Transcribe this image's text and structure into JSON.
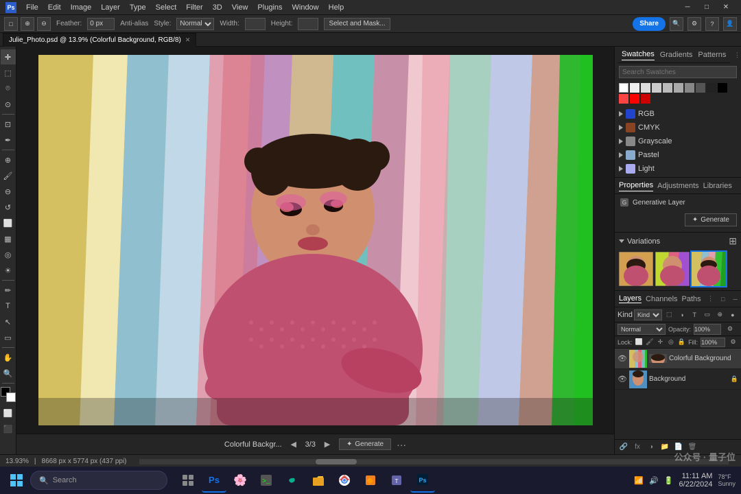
{
  "titlebar": {
    "app_title": "Photoshop",
    "file_name": "Julie_Photo.psd @ 13.9% (Colorful Background, RGB/8)",
    "menus": [
      "File",
      "Edit",
      "Image",
      "Layer",
      "Type",
      "Select",
      "Filter",
      "3D",
      "View",
      "Plugins",
      "Window",
      "Help"
    ],
    "win_min": "─",
    "win_max": "□",
    "win_close": "✕"
  },
  "optionsbar": {
    "feather_label": "Feather:",
    "feather_value": "0 px",
    "anti_alias_label": "Anti-alias",
    "style_label": "Style:",
    "style_value": "Normal",
    "width_label": "Width:",
    "height_label": "Height:",
    "select_mask_btn": "Select and Mask...",
    "share_btn": "Share"
  },
  "tabs": [
    {
      "label": "Julie_Photo.psd @ 13.9% (Colorful Background, RGB/8)",
      "active": true
    }
  ],
  "swatches": {
    "tabs": [
      {
        "label": "Swatches",
        "active": true
      },
      {
        "label": "Gradients",
        "active": false
      },
      {
        "label": "Patterns",
        "active": false
      }
    ],
    "search_placeholder": "Search Swatches",
    "color_row": [
      "#ffffff",
      "#eeeeee",
      "#dddddd",
      "#cccccc",
      "#bbbbbb",
      "#aaaaaa",
      "#888888",
      "#555555",
      "#222222",
      "#000000",
      "#ff4444",
      "#ff0000",
      "#cc0000"
    ],
    "groups": [
      {
        "label": "RGB",
        "color": "#2244cc"
      },
      {
        "label": "CMYK",
        "color": "#884422"
      },
      {
        "label": "Grayscale",
        "color": "#888888"
      },
      {
        "label": "Pastel",
        "color": "#88aacc"
      },
      {
        "label": "Light",
        "color": "#aaaaee"
      }
    ]
  },
  "properties": {
    "tabs": [
      {
        "label": "Properties",
        "active": true
      },
      {
        "label": "Adjustments",
        "active": false
      },
      {
        "label": "Libraries",
        "active": false
      }
    ],
    "generative_label": "Generative Layer",
    "generate_btn": "Generate"
  },
  "variations": {
    "label": "Variations",
    "thumbs": [
      {
        "id": 1,
        "selected": false
      },
      {
        "id": 2,
        "selected": false
      },
      {
        "id": 3,
        "selected": true
      }
    ]
  },
  "layers": {
    "tabs": [
      {
        "label": "Layers",
        "active": true
      },
      {
        "label": "Channels",
        "active": false
      },
      {
        "label": "Paths",
        "active": false
      }
    ],
    "kind_label": "Kind",
    "blend_mode": "Normal",
    "opacity_label": "Opacity:",
    "opacity_value": "100%",
    "lock_label": "Lock:",
    "fill_label": "Fill:",
    "fill_value": "100%",
    "items": [
      {
        "name": "Colorful Background",
        "visible": true,
        "active": true,
        "has_lock": false
      },
      {
        "name": "Background",
        "visible": true,
        "active": false,
        "has_lock": true
      }
    ]
  },
  "canvas_bottom": {
    "file_name": "Colorful Backgr...",
    "page_current": "3",
    "page_total": "3",
    "generate_btn": "Generate"
  },
  "statusbar": {
    "zoom": "13.93%",
    "dimensions": "8668 px x 5774 px (437 ppi)"
  },
  "taskbar": {
    "search_placeholder": "Search",
    "time": "11:11 AM",
    "date": "6/22/2024",
    "weather": "78°F",
    "weather_desc": "Sunny",
    "icons": [
      "🪟",
      "🔍",
      "🌸",
      "📁",
      "🌐",
      "📂",
      "🔶",
      "💬",
      "🅰️",
      "🔵"
    ],
    "start_icon": "⊞"
  },
  "watermark": {
    "text": "公众号 · 量子位"
  },
  "icons": {
    "search": "🔍",
    "eye": "👁",
    "folder": "📁",
    "new": "📄",
    "trash": "🗑",
    "lock": "🔒",
    "chevron_down": "▼",
    "chevron_right": "▶",
    "grid": "⊞",
    "generate_star": "✦"
  }
}
